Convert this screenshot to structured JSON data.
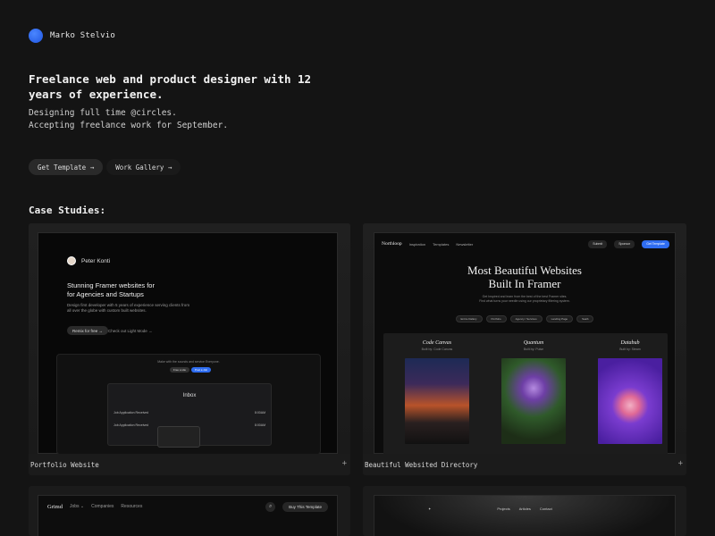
{
  "brand": {
    "name": "Marko Stelvio",
    "accent": "#2f6df0"
  },
  "hero": {
    "headline": "Freelance web and product designer with 12 years of experience.",
    "sub_line_1": "Designing full time @circles.",
    "sub_line_2": "Accepting freelance work for September."
  },
  "actions": {
    "primary": "Get Template →",
    "secondary": "Work Gallery →"
  },
  "case_studies": {
    "title": "Case Studies:",
    "items": [
      {
        "label": "Portfolio Website",
        "plus": "+",
        "preview": {
          "name": "Peter Konti",
          "headline_1": "Stunning Framer websites for",
          "headline_2": "for Agencies and Startups",
          "body": "Design first developer with 5 years of experience serving clients from all over the globe with custom built websites.",
          "btn_primary": "Remix for free →",
          "btn_secondary": "Check out Light Mode →",
          "panel_text": "Make with the sounds and service Everyone.",
          "pill_1": "Free a site",
          "pill_2": "Post a Job",
          "inbox_title": "Inbox",
          "row_1_left": "Job Application Received",
          "row_1_right": "8:00AM",
          "row_2_left": "Job Application Received",
          "row_2_right": "8:00AM"
        }
      },
      {
        "label": "Beautiful Websited Directory",
        "plus": "+",
        "preview": {
          "logo": "Northloop",
          "nav_1": "Inspiration",
          "nav_2": "Templates",
          "nav_3": "Newsletter",
          "btn_submit": "Submit",
          "btn_sponsor": "Sponsor",
          "btn_get": "Get Template",
          "headline_1": "Most Beautiful Websites",
          "headline_2": "Built In Framer",
          "body_1": "Get Inspired and learn from the best of the best Framer sites.",
          "body_2": "Find what turns your needle using our proprietary filtering system.",
          "tags": [
            "Entire Dallery",
            "Portfolio",
            "Agency / Services",
            "Landing Page",
            "SaaS"
          ],
          "cols": [
            {
              "title": "Code Canvas",
              "sub": "Built by: Code Canvas"
            },
            {
              "title": "Quantum",
              "sub": "Built by: Pulse"
            },
            {
              "title": "Databub",
              "sub": "Built by: Steam"
            }
          ]
        }
      },
      {
        "label": "",
        "preview": {
          "logo": "Grimd",
          "nav_1": "Jobs ⌄",
          "nav_2": "Companies",
          "nav_3": "Resources",
          "search_icon": "search-icon",
          "btn": "Buy This Template"
        }
      },
      {
        "label": "",
        "preview": {
          "mark": "✦",
          "nav_1": "Projects",
          "nav_2": "Articles",
          "nav_3": "Contact"
        }
      }
    ]
  }
}
